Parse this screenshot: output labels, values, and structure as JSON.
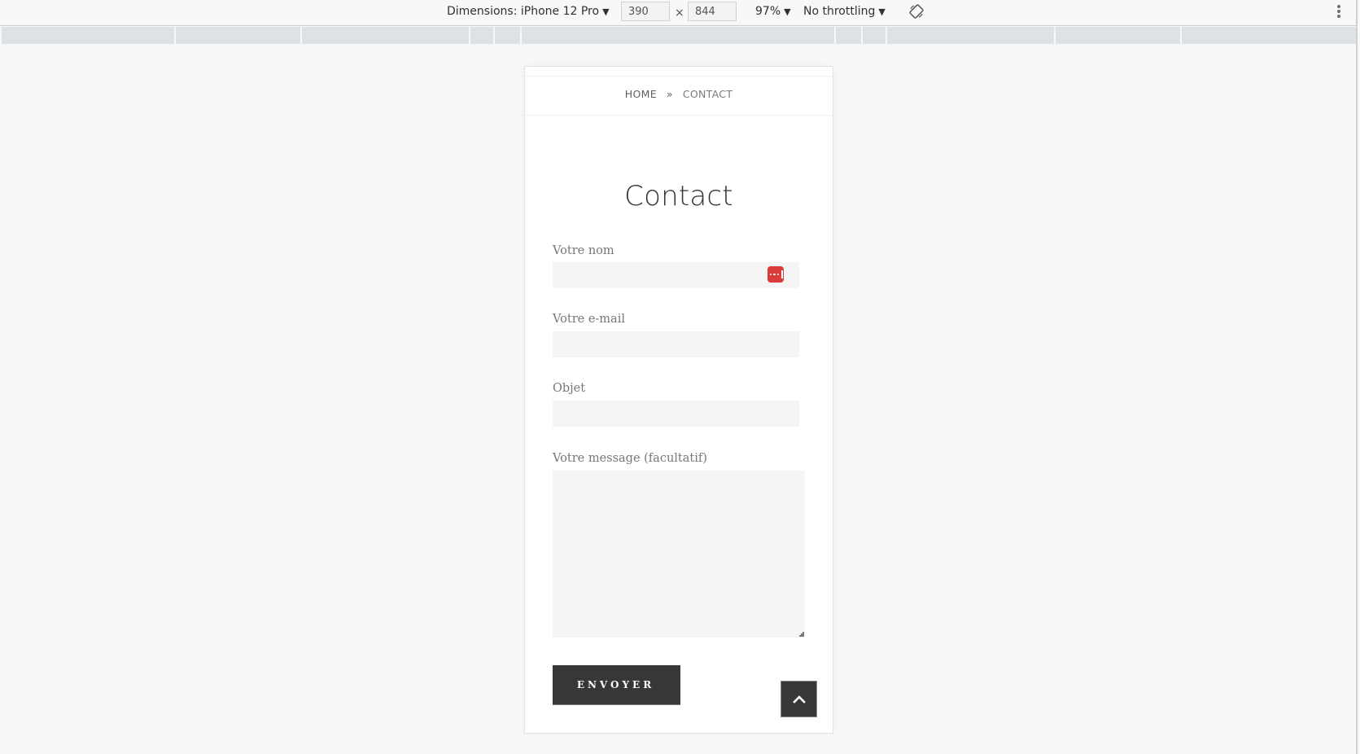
{
  "devtools": {
    "dimensions_label": "Dimensions: iPhone 12 Pro",
    "width_value": "390",
    "height_value": "844",
    "times_symbol": "×",
    "zoom_label": "97%",
    "throttling_label": "No throttling",
    "caret": "▼",
    "icons": [
      "rotate-icon",
      "kebab-menu-icon"
    ]
  },
  "page": {
    "breadcrumb": {
      "home": "HOME",
      "separator": "»",
      "current": "CONTACT"
    },
    "title": "Contact",
    "form": {
      "fields": [
        {
          "label": "Votre nom",
          "value": "",
          "placeholder": ""
        },
        {
          "label": "Votre e-mail",
          "value": "",
          "placeholder": ""
        },
        {
          "label": "Objet",
          "value": "",
          "placeholder": ""
        }
      ],
      "message": {
        "label": "Votre message (facultatif)",
        "value": "",
        "placeholder": ""
      },
      "submit_label": "ENVOYER"
    },
    "colors": {
      "button_bg": "#373737",
      "password_manager_icon": "#d93a3a",
      "field_bg": "#f5f5f5"
    }
  }
}
